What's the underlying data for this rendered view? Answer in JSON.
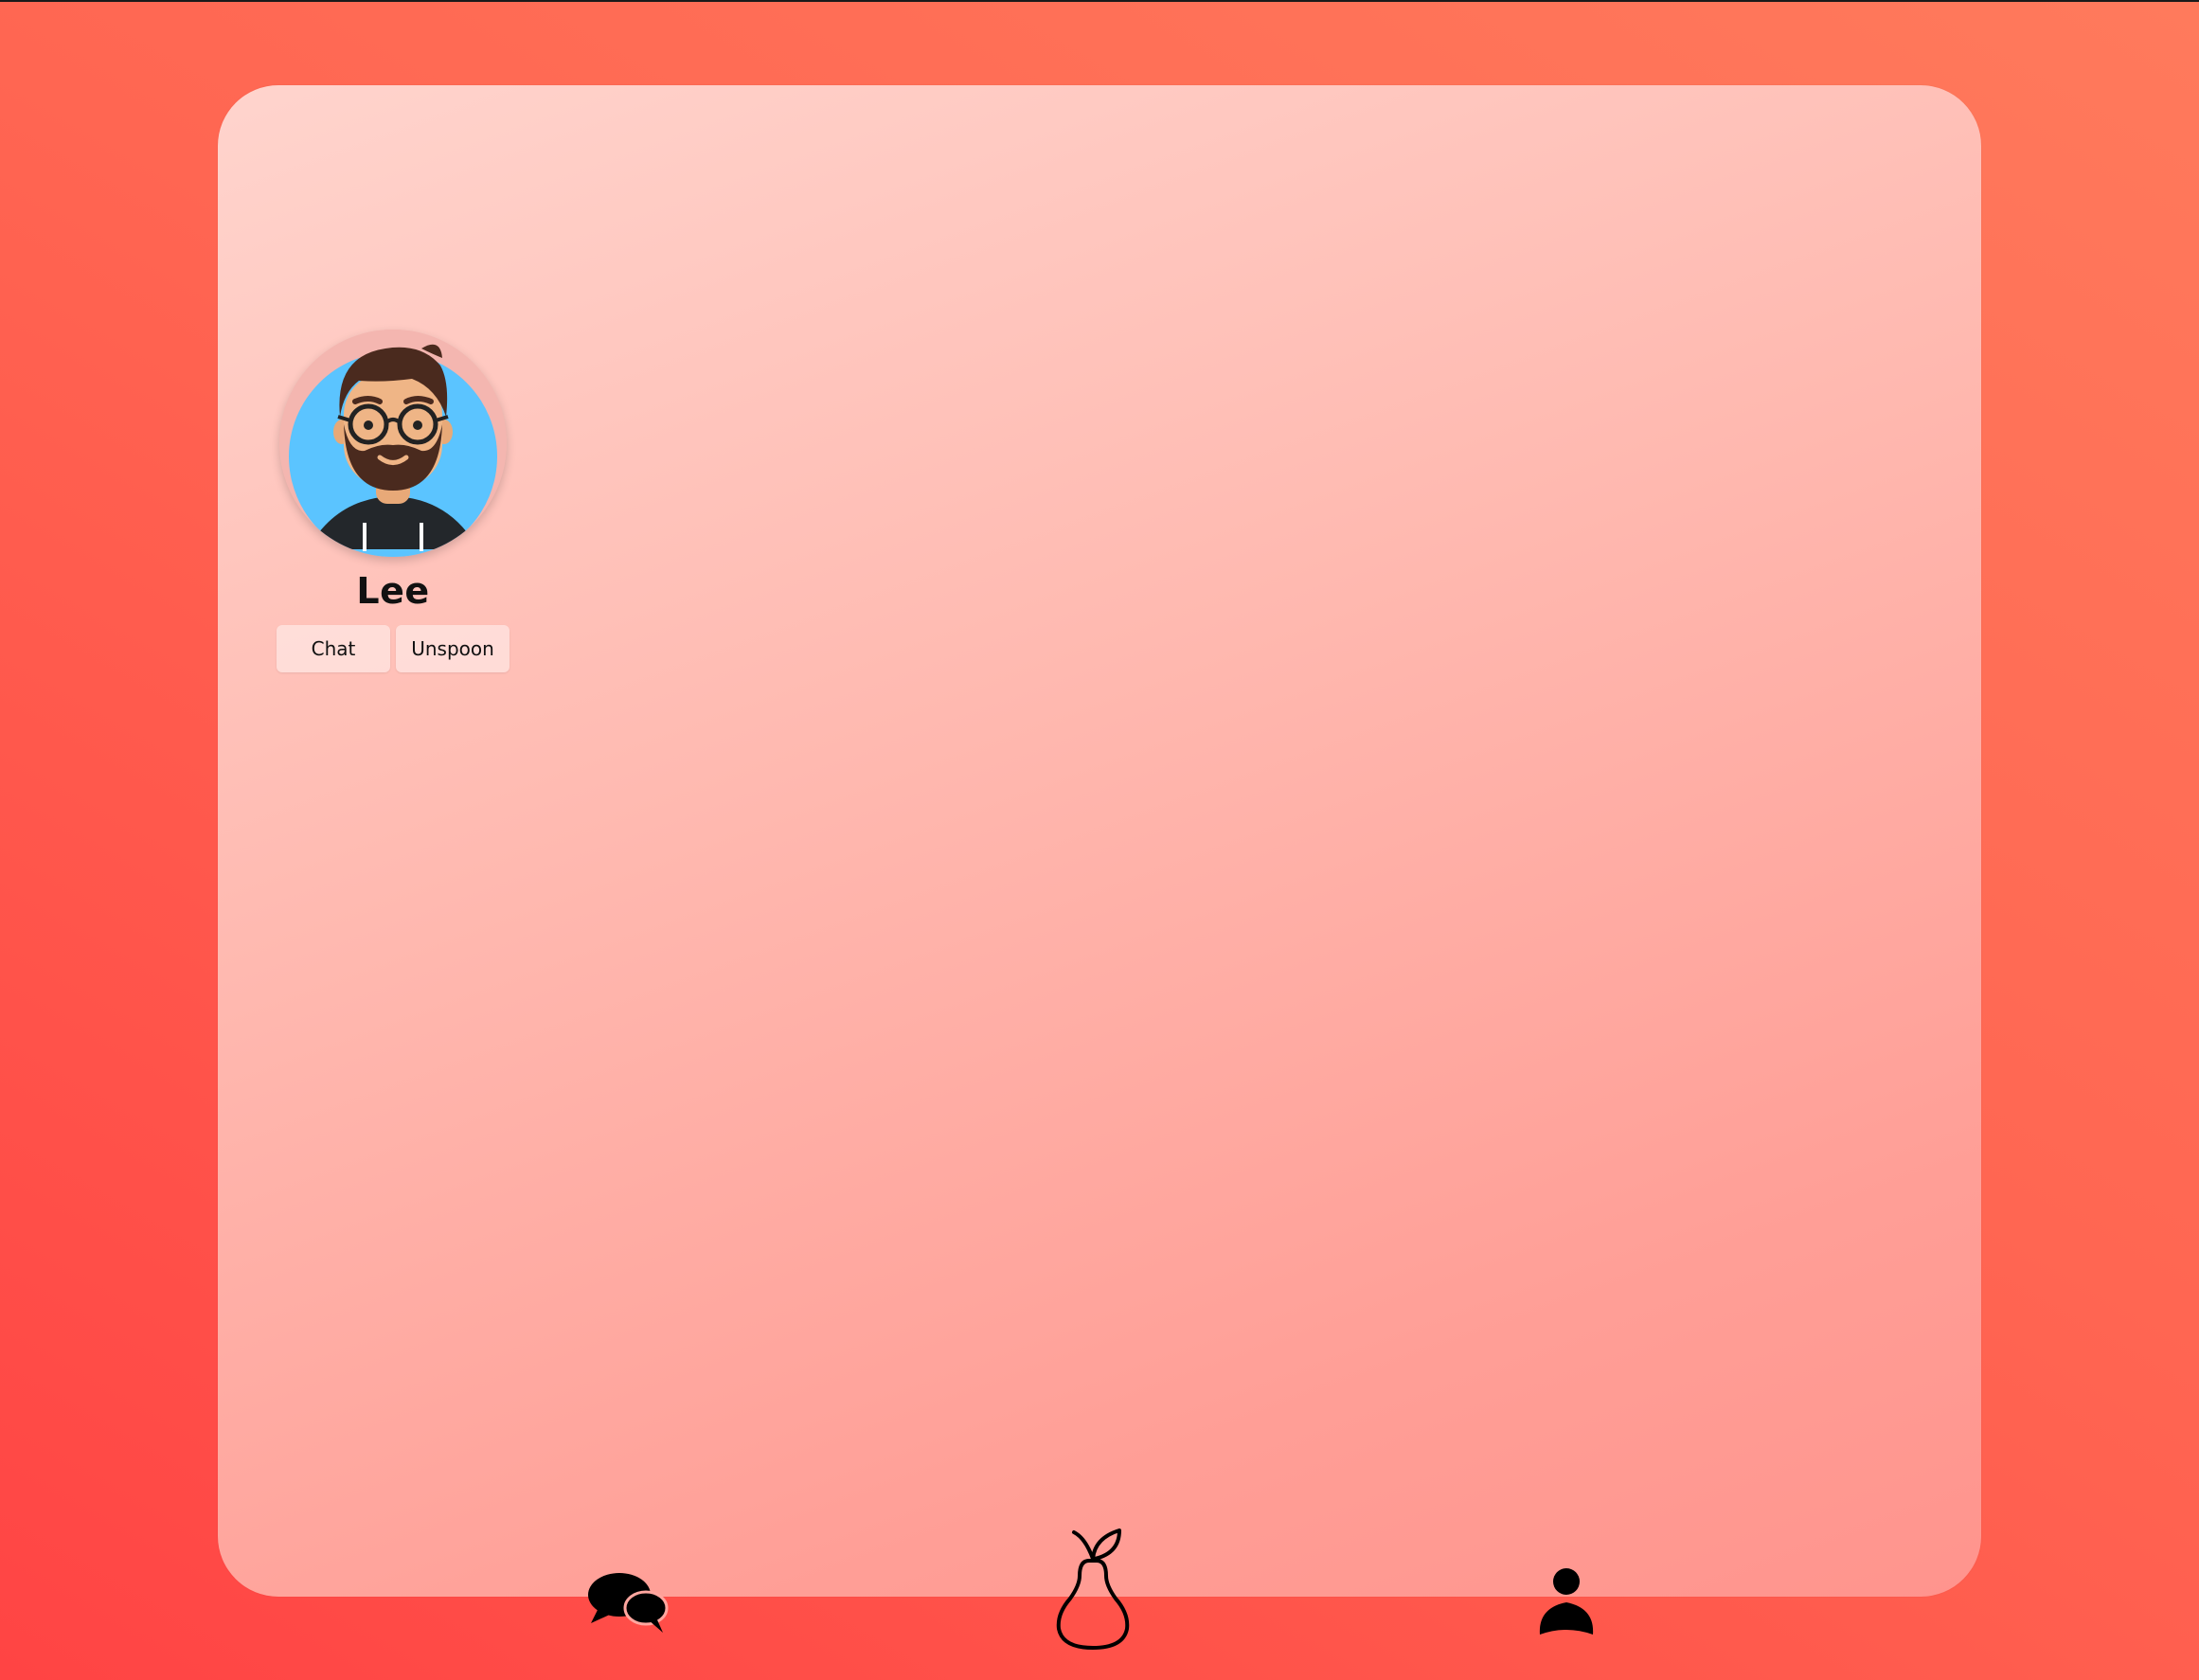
{
  "profile": {
    "name": "Lee",
    "avatar_icon": "bearded-man-with-glasses-avatar",
    "buttons": {
      "chat": "Chat",
      "unspoon": "Unspoon"
    }
  },
  "nav": {
    "items": [
      {
        "icon": "speech-bubbles-icon"
      },
      {
        "icon": "pear-icon"
      },
      {
        "icon": "person-icon"
      }
    ]
  },
  "colors": {
    "background_start": "#ff7a5c",
    "background_end": "#ff4444",
    "panel_light": "#ffd4cd",
    "panel_dark": "#ff948d",
    "avatar_bg": "#5bc4ff"
  }
}
